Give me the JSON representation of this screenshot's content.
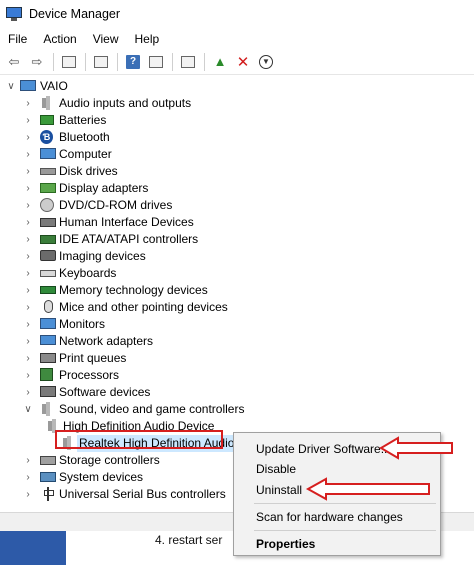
{
  "window": {
    "title": "Device Manager"
  },
  "menu": [
    "File",
    "Action",
    "View",
    "Help"
  ],
  "tree": {
    "root": "VAIO",
    "categories": [
      {
        "label": "Audio inputs and outputs",
        "icon": "speaker-icon"
      },
      {
        "label": "Batteries",
        "icon": "battery-icon"
      },
      {
        "label": "Bluetooth",
        "icon": "bluetooth-icon"
      },
      {
        "label": "Computer",
        "icon": "computer-icon"
      },
      {
        "label": "Disk drives",
        "icon": "disk-drive-icon"
      },
      {
        "label": "Display adapters",
        "icon": "display-adapter-icon"
      },
      {
        "label": "DVD/CD-ROM drives",
        "icon": "dvd-icon"
      },
      {
        "label": "Human Interface Devices",
        "icon": "hid-icon"
      },
      {
        "label": "IDE ATA/ATAPI controllers",
        "icon": "ide-controller-icon"
      },
      {
        "label": "Imaging devices",
        "icon": "camera-icon"
      },
      {
        "label": "Keyboards",
        "icon": "keyboard-icon"
      },
      {
        "label": "Memory technology devices",
        "icon": "memory-icon"
      },
      {
        "label": "Mice and other pointing devices",
        "icon": "mouse-icon"
      },
      {
        "label": "Monitors",
        "icon": "monitor-icon"
      },
      {
        "label": "Network adapters",
        "icon": "network-icon"
      },
      {
        "label": "Print queues",
        "icon": "printer-icon"
      },
      {
        "label": "Processors",
        "icon": "processor-icon"
      },
      {
        "label": "Software devices",
        "icon": "software-device-icon"
      },
      {
        "label": "Sound, video and game controllers",
        "icon": "speaker-icon",
        "expanded": true,
        "children": [
          "High Definition Audio Device",
          "Realtek High Definition Audio"
        ]
      },
      {
        "label": "Storage controllers",
        "icon": "storage-icon"
      },
      {
        "label": "System devices",
        "icon": "system-device-icon"
      },
      {
        "label": "Universal Serial Bus controllers",
        "icon": "usb-icon"
      }
    ]
  },
  "context_menu": {
    "items": [
      "Update Driver Software...",
      "Disable",
      "Uninstall",
      "Scan for hardware changes",
      "Properties"
    ]
  },
  "bottom": {
    "text": "4. restart ser"
  },
  "colors": {
    "highlight": "#d61f1f",
    "arrow": "#d61f1f"
  }
}
